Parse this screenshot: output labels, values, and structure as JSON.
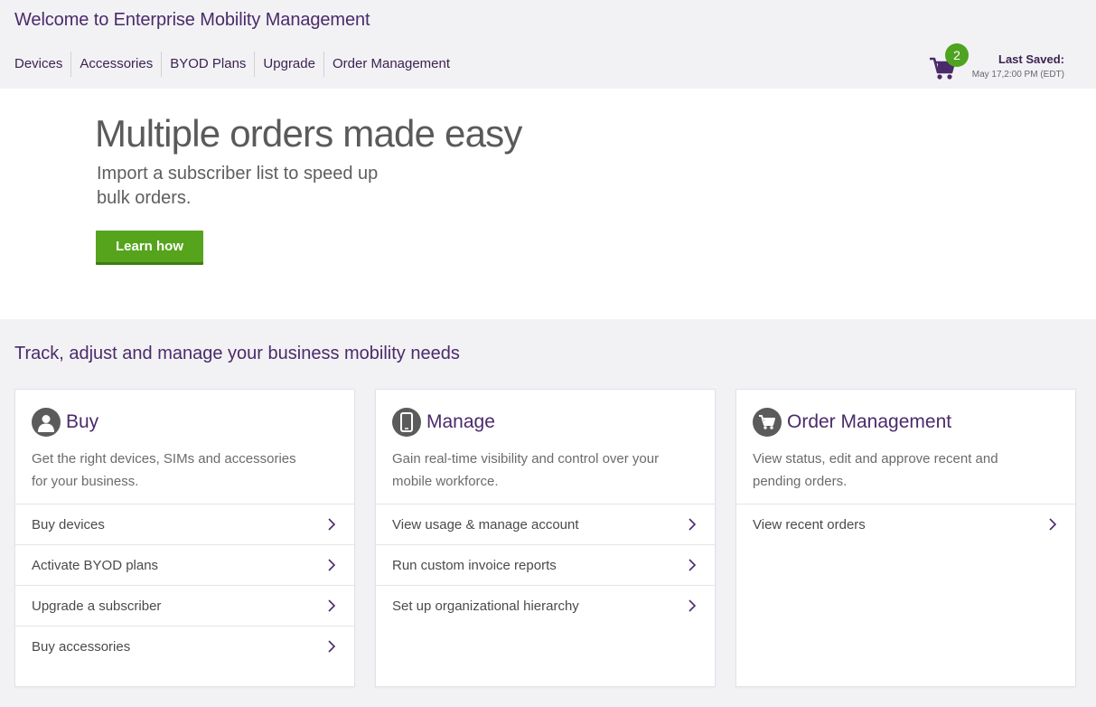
{
  "header": {
    "title": "Welcome to Enterprise Mobility Management",
    "nav": [
      "Devices",
      "Accessories",
      "BYOD Plans",
      "Upgrade",
      "Order Management"
    ],
    "cart_count": "2",
    "last_saved_label": "Last Saved:",
    "last_saved_time": "May 17,2:00 PM (EDT)"
  },
  "hero": {
    "title": "Multiple orders made easy",
    "subtitle": "Import a subscriber list to speed up bulk orders.",
    "button_label": "Learn how"
  },
  "section": {
    "title": "Track, adjust and manage your business mobility needs"
  },
  "cards": [
    {
      "icon": "user-icon",
      "title": "Buy",
      "description": "Get the right devices, SIMs and accessories for your business.",
      "links": [
        "Buy devices",
        "Activate BYOD plans",
        "Upgrade a subscriber",
        "Buy accessories"
      ]
    },
    {
      "icon": "phone-icon",
      "title": "Manage",
      "description": "Gain real-time visibility and control over your mobile workforce.",
      "links": [
        "View usage & manage account",
        "Run custom invoice reports",
        "Set up organizational hierarchy"
      ]
    },
    {
      "icon": "cart-icon",
      "title": "Order Management",
      "description": "View status, edit and approve recent and pending orders.",
      "links": [
        "View recent orders"
      ]
    }
  ],
  "colors": {
    "brand_purple": "#4b2a6b",
    "accent_green": "#56a41c",
    "background": "#f2f2f4"
  }
}
